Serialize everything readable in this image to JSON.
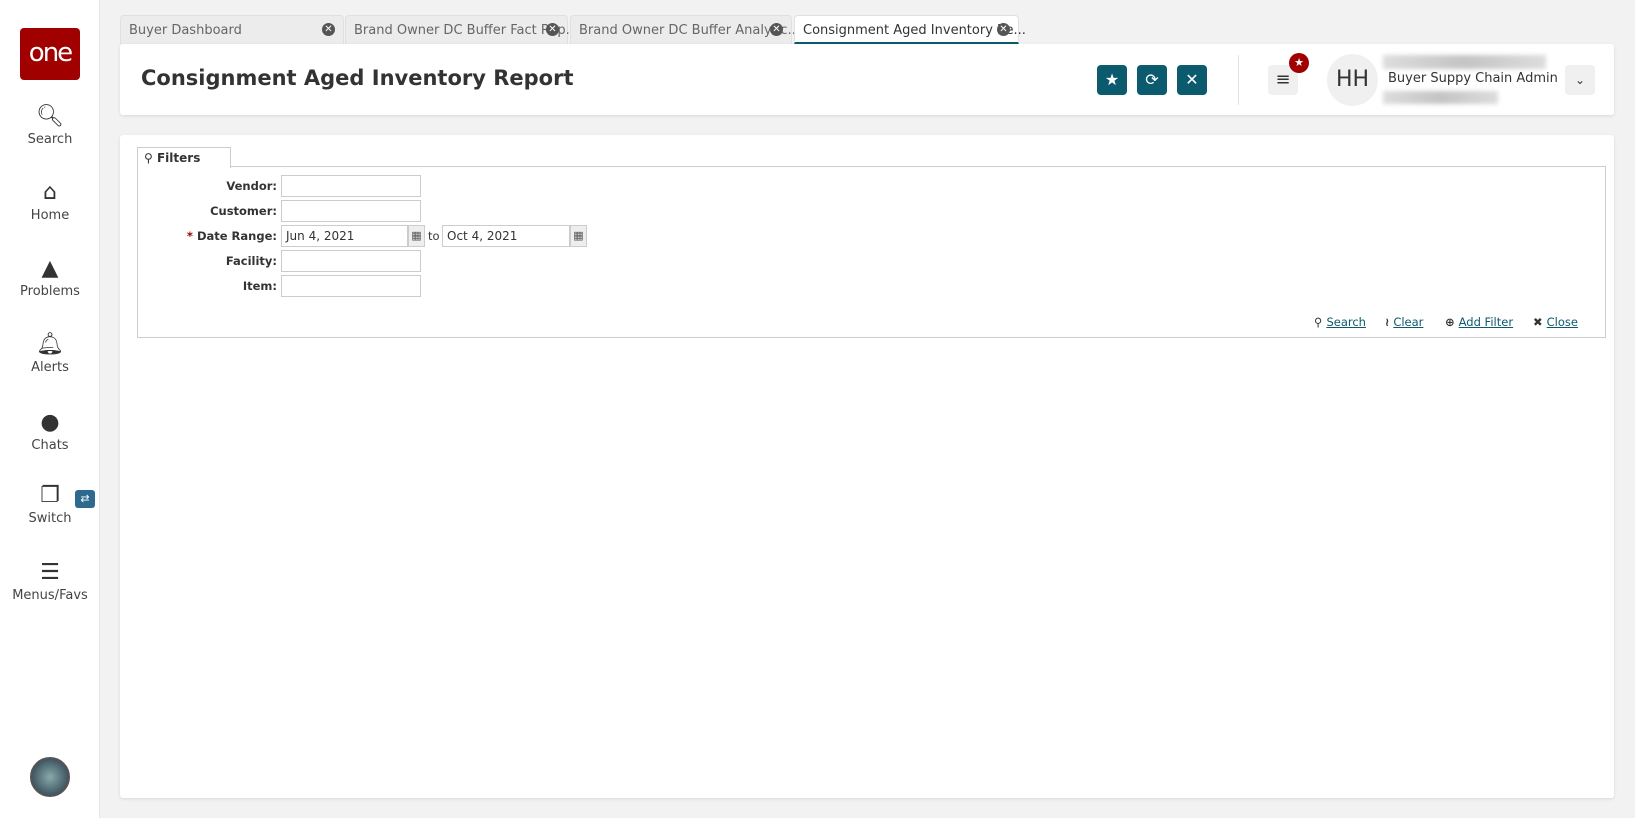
{
  "sidebar": {
    "logo": "one",
    "items": [
      {
        "label": "Search",
        "icon": "search-icon"
      },
      {
        "label": "Home",
        "icon": "home-icon"
      },
      {
        "label": "Problems",
        "icon": "warning-icon"
      },
      {
        "label": "Alerts",
        "icon": "bell-icon"
      },
      {
        "label": "Chats",
        "icon": "chat-icon"
      },
      {
        "label": "Switch",
        "icon": "switch-icon"
      },
      {
        "label": "Menus/Favs",
        "icon": "menu-icon"
      }
    ]
  },
  "tabs": [
    {
      "label": "Buyer Dashboard"
    },
    {
      "label": "Brand Owner DC Buffer Fact Rep..."
    },
    {
      "label": "Brand Owner DC Buffer Analytic..."
    },
    {
      "label": "Consignment Aged Inventory Re...",
      "active": true
    }
  ],
  "header": {
    "title": "Consignment Aged Inventory Report",
    "user_initials": "HH",
    "user_role": "Buyer Suppy Chain Admin"
  },
  "filters": {
    "tab_label": "Filters",
    "fields": {
      "vendor": {
        "label": "Vendor:",
        "value": ""
      },
      "customer": {
        "label": "Customer:",
        "value": ""
      },
      "date_range": {
        "required": "*",
        "label": "Date Range:",
        "from": "Jun 4, 2021",
        "to_label": "to",
        "to": "Oct 4, 2021"
      },
      "facility": {
        "label": "Facility:",
        "value": ""
      },
      "item": {
        "label": "Item:",
        "value": ""
      }
    },
    "actions": {
      "search": "Search",
      "clear": "Clear",
      "add_filter": "Add Filter",
      "close": "Close"
    }
  },
  "colors": {
    "brand": "#a00000",
    "accent": "#0b5a6e"
  }
}
